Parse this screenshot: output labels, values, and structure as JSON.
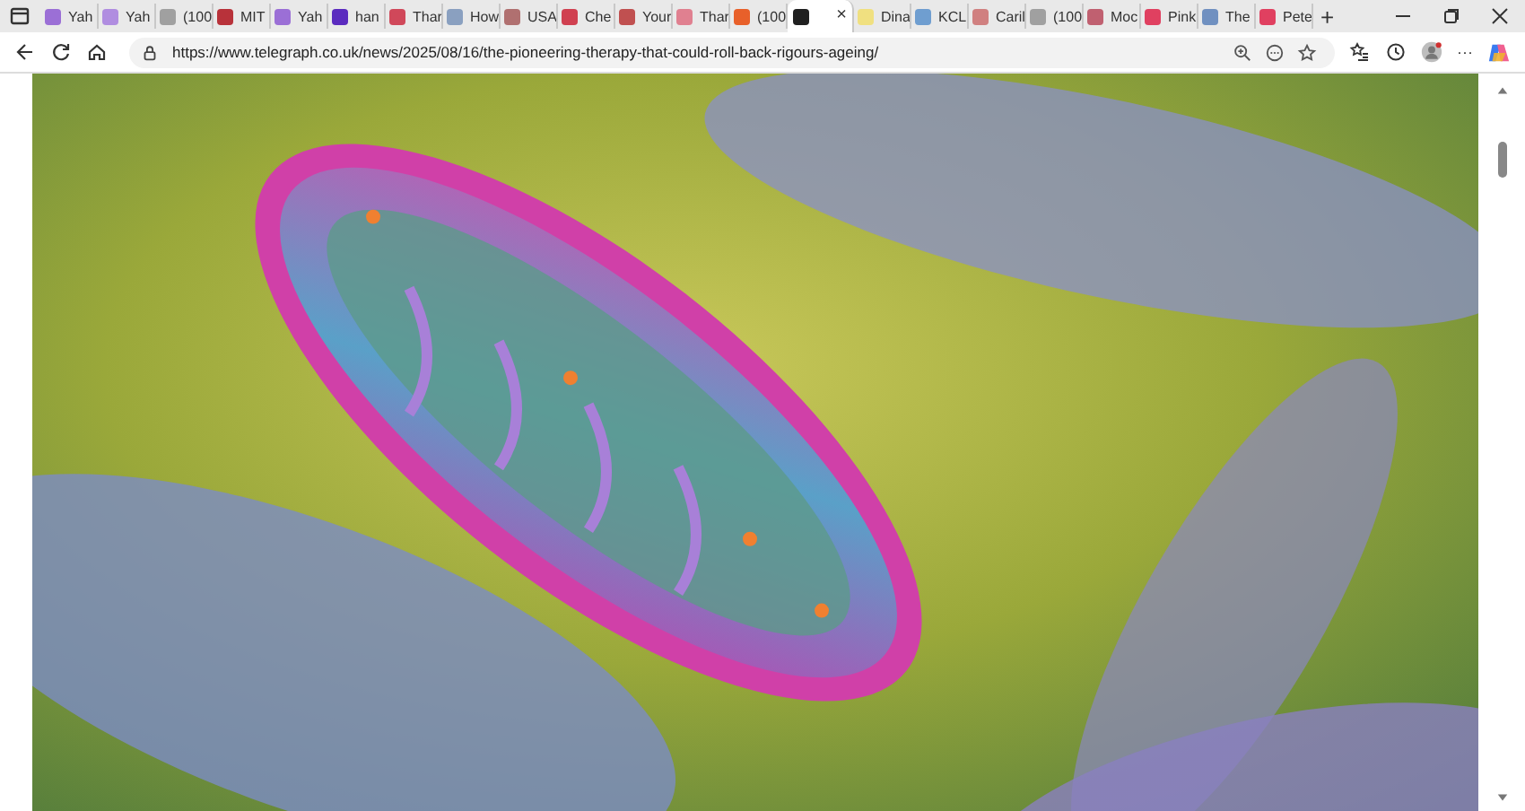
{
  "tabs": [
    {
      "title": "Yah",
      "color": "#9b6fd6",
      "selected": false
    },
    {
      "title": "Yah",
      "color": "#b08de0",
      "selected": false
    },
    {
      "title": "(100",
      "color": "#a0a0a0",
      "selected": false
    },
    {
      "title": "MIT",
      "color": "#b8323a",
      "selected": false
    },
    {
      "title": "Yah",
      "color": "#9b6fd6",
      "selected": false
    },
    {
      "title": "han",
      "color": "#5b2bbf",
      "selected": false
    },
    {
      "title": "Thar",
      "color": "#d0485a",
      "selected": false
    },
    {
      "title": "How",
      "color": "#8aa0c0",
      "selected": false
    },
    {
      "title": "USA",
      "color": "#b07070",
      "selected": false
    },
    {
      "title": "Che",
      "color": "#d04050",
      "selected": false
    },
    {
      "title": "Your",
      "color": "#c05050",
      "selected": false
    },
    {
      "title": "Thar",
      "color": "#e08090",
      "selected": false
    },
    {
      "title": "(100",
      "color": "#e8602a",
      "selected": false
    },
    {
      "color": "#202020",
      "selected": true
    },
    {
      "title": "Dina",
      "color": "#f0e080",
      "selected": false
    },
    {
      "title": "KCL",
      "color": "#6f9ed0",
      "selected": false
    },
    {
      "title": "Caril",
      "color": "#d08080",
      "selected": false
    },
    {
      "title": "(100",
      "color": "#a0a0a0",
      "selected": false
    },
    {
      "title": "Moc",
      "color": "#c06070",
      "selected": false
    },
    {
      "title": "Pink",
      "color": "#e04060",
      "selected": false
    },
    {
      "title": "The",
      "color": "#7090c0",
      "selected": false
    },
    {
      "title": "Pete",
      "color": "#e04060",
      "selected": false
    }
  ],
  "close_tab": "×",
  "new_tab": "+",
  "address": {
    "url": "https://www.telegraph.co.uk/news/2025/08/16/the-pioneering-therapy-that-could-roll-back-rigours-ageing/"
  },
  "more_menu": "···"
}
